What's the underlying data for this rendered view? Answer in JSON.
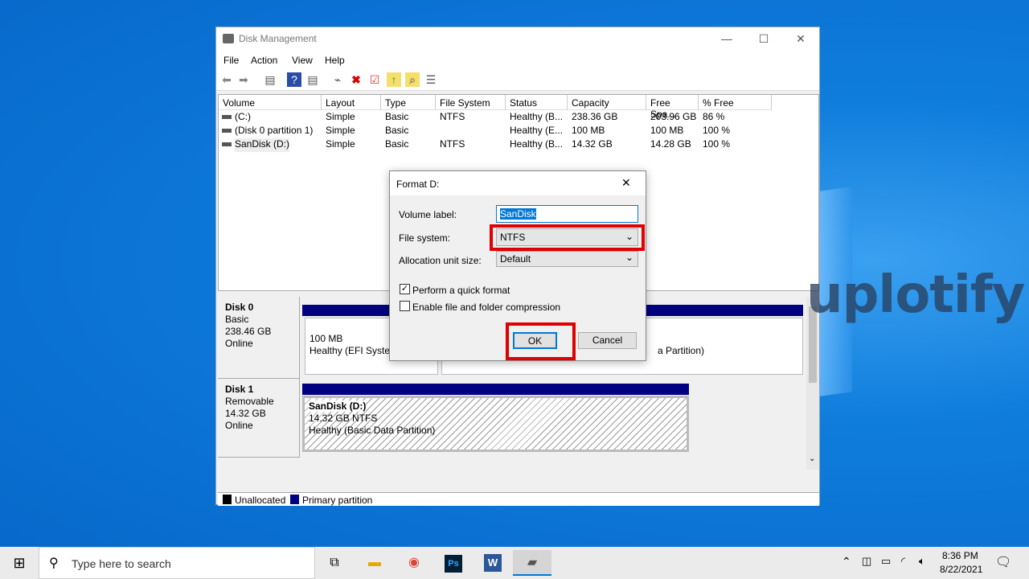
{
  "window": {
    "title": "Disk Management",
    "minimize": "—",
    "maximize": "☐",
    "close": "✕"
  },
  "menu": [
    "File",
    "Action",
    "View",
    "Help"
  ],
  "toolbar_icons": [
    "back-icon",
    "forward-icon",
    "console-icon",
    "help-icon",
    "properties-icon",
    "connect-icon",
    "delete-icon",
    "check-icon",
    "folder-up-icon",
    "search-folder-icon",
    "list-icon"
  ],
  "columns": [
    "Volume",
    "Layout",
    "Type",
    "File System",
    "Status",
    "Capacity",
    "Free Spa...",
    "% Free"
  ],
  "rows": [
    [
      "(C:)",
      "Simple",
      "Basic",
      "NTFS",
      "Healthy (B...",
      "238.36 GB",
      "203.96 GB",
      "86 %"
    ],
    [
      "(Disk 0 partition 1)",
      "Simple",
      "Basic",
      "",
      "Healthy (E...",
      "100 MB",
      "100 MB",
      "100 %"
    ],
    [
      "SanDisk (D:)",
      "Simple",
      "Basic",
      "NTFS",
      "Healthy (B...",
      "14.32 GB",
      "14.28 GB",
      "100 %"
    ]
  ],
  "disks": [
    {
      "name": "Disk 0",
      "type": "Basic",
      "size": "238.46 GB",
      "status": "Online",
      "p1_size": "100 MB",
      "p1_status": "Healthy (EFI System",
      "p2_status": "a Partition)"
    },
    {
      "name": "Disk 1",
      "type": "Removable",
      "size": "14.32 GB",
      "status": "Online",
      "p_name": "SanDisk  (D:)",
      "p_size": "14.32 GB NTFS",
      "p_status": "Healthy (Basic Data Partition)"
    }
  ],
  "legend": {
    "unallocated": "Unallocated",
    "primary": "Primary partition",
    "colors": {
      "unallocated": "#000000",
      "primary": "#000080"
    }
  },
  "dialog": {
    "title": "Format D:",
    "close": "✕",
    "volume_label": "Volume label:",
    "volume_value": "SanDisk",
    "file_system_label": "File system:",
    "file_system_value": "NTFS",
    "alloc_label": "Allocation unit size:",
    "alloc_value": "Default",
    "quick_format": "Perform a quick format",
    "quick_checked": true,
    "compression": "Enable file and folder compression",
    "compression_checked": false,
    "ok": "OK",
    "cancel": "Cancel"
  },
  "watermark": "uplotify",
  "taskbar": {
    "search_placeholder": "Type here to search",
    "time": "8:36 PM",
    "date": "8/22/2021"
  }
}
